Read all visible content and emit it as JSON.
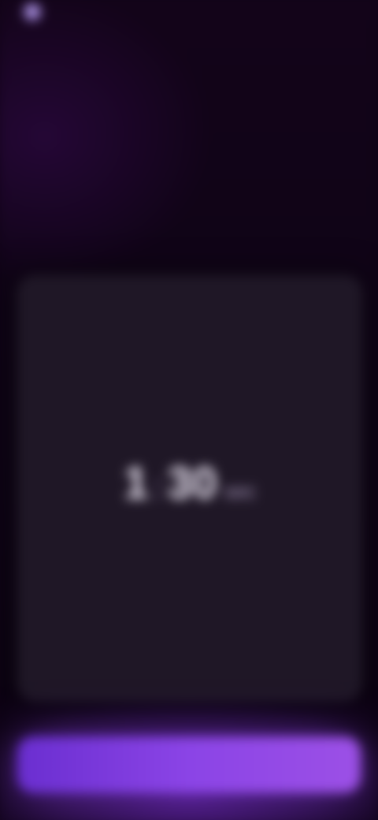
{
  "app": {
    "logo_text": ""
  },
  "nav": {
    "title": "",
    "action_label": ""
  },
  "hero": {
    "headline": "",
    "headline_accent": "",
    "subtitle": ""
  },
  "timer": {
    "minutes": "1",
    "seconds": "30",
    "unit": "sec"
  },
  "cta": {
    "label": ""
  },
  "colors": {
    "background": "#0e0414",
    "card": "#1f1726",
    "accent": "#9c50e6",
    "headline_accent": "#b68af0"
  }
}
